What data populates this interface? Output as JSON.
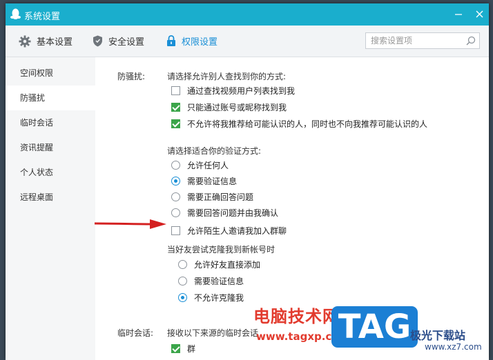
{
  "window": {
    "title": "系统设置"
  },
  "toolbar": {
    "tabs": [
      {
        "label": "基本设置",
        "icon": "gear-icon"
      },
      {
        "label": "安全设置",
        "icon": "shield-icon"
      },
      {
        "label": "权限设置",
        "icon": "lock-icon",
        "active": true
      }
    ],
    "search_placeholder": "搜索设置项"
  },
  "sidebar": {
    "items": [
      {
        "label": "空间权限"
      },
      {
        "label": "防骚扰",
        "active": true
      },
      {
        "label": "临时会话"
      },
      {
        "label": "资讯提醒"
      },
      {
        "label": "个人状态"
      },
      {
        "label": "远程桌面"
      }
    ]
  },
  "anti_harass": {
    "label": "防骚扰:",
    "find_prompt": "请选择允许别人查找到你的方式:",
    "find_options": [
      {
        "label": "通过查找视频用户列表找到我",
        "checked": false
      },
      {
        "label": "只能通过账号或昵称找到我",
        "checked": true
      },
      {
        "label": "不允许将我推荐给可能认识的人，同时也不向我推荐可能认识的人",
        "checked": true
      }
    ],
    "verify_prompt": "请选择适合你的验证方式:",
    "verify_options": [
      {
        "label": "允许任何人",
        "selected": false
      },
      {
        "label": "需要验证信息",
        "selected": true
      },
      {
        "label": "需要正确回答问题",
        "selected": false
      },
      {
        "label": "需要回答问题并由我确认",
        "selected": false
      }
    ],
    "group_invite": {
      "label": "允许陌生人邀请我加入群聊",
      "checked": false
    },
    "clone_prompt": "当好友尝试克隆我到新帐号时",
    "clone_options": [
      {
        "label": "允许好友直接添加",
        "selected": false
      },
      {
        "label": "需要验证信息",
        "selected": false
      },
      {
        "label": "不允许克隆我",
        "selected": true
      }
    ]
  },
  "temp_chat": {
    "label": "临时会话:",
    "prompt": "接收以下来源的临时会话",
    "options": [
      {
        "label": "群",
        "checked": true
      }
    ]
  },
  "watermark": {
    "site_cn": "电脑技术网",
    "site_url": "www.tagxp.com",
    "logo": "TAG",
    "site2_cn": "极光下载站",
    "site2_url": "www.xz7.com"
  },
  "colors": {
    "titlebar": "#1aaecd",
    "accent": "#1a8fd6",
    "check": "#3ba54a",
    "arrow": "#d42020"
  }
}
